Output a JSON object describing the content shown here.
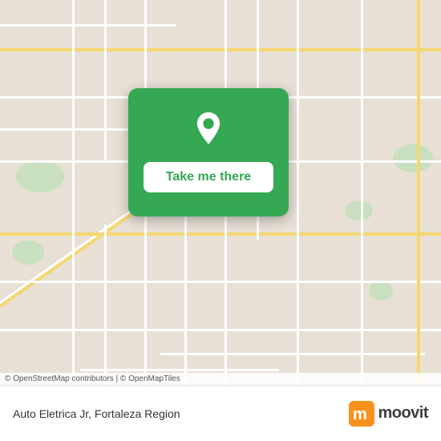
{
  "map": {
    "attribution": "© OpenStreetMap contributors | © OpenMapTiles",
    "background_color": "#e8e0d5"
  },
  "card": {
    "button_label": "Take me there",
    "pin_color": "#ffffff"
  },
  "bottom_bar": {
    "title": "Auto Eletrica Jr, Fortaleza Region",
    "logo_text": "moovit"
  }
}
